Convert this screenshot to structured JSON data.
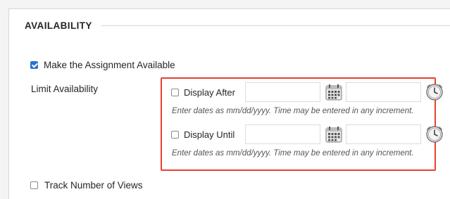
{
  "section": {
    "title": "AVAILABILITY"
  },
  "make_available": {
    "label": "Make the Assignment Available",
    "checked": true
  },
  "limit_availability": {
    "label": "Limit Availability",
    "display_after": {
      "label": "Display After",
      "checked": false,
      "date_value": "",
      "time_value": "",
      "hint": "Enter dates as mm/dd/yyyy. Time may be entered in any increment."
    },
    "display_until": {
      "label": "Display Until",
      "checked": false,
      "date_value": "",
      "time_value": "",
      "hint": "Enter dates as mm/dd/yyyy. Time may be entered in any increment."
    }
  },
  "track_views": {
    "label": "Track Number of Views",
    "checked": false
  },
  "colors": {
    "highlight": "#e8412c",
    "checkbox_checked": "#2c6fd1"
  },
  "icons": {
    "calendar": "calendar-icon",
    "clock": "clock-icon"
  }
}
